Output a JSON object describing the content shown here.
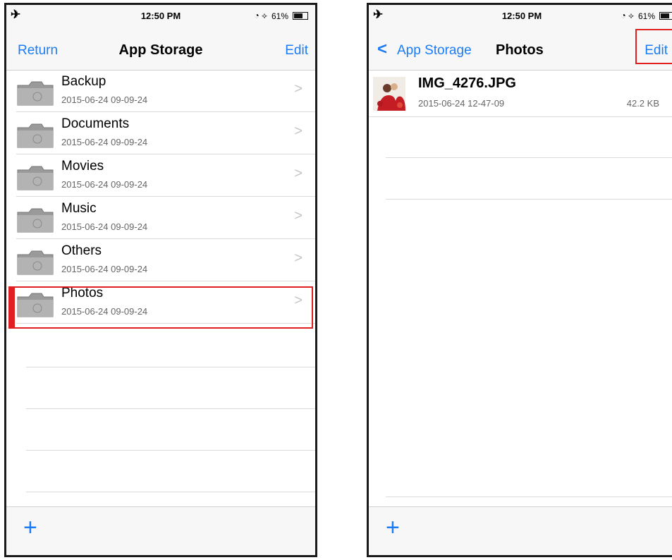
{
  "status": {
    "time": "12:50 PM",
    "battery": "61%"
  },
  "left": {
    "nav": {
      "left": "Return",
      "title": "App Storage",
      "right": "Edit"
    },
    "rows": [
      {
        "name": "Backup",
        "date": "2015-06-24 09-09-24"
      },
      {
        "name": "Documents",
        "date": "2015-06-24 09-09-24"
      },
      {
        "name": "Movies",
        "date": "2015-06-24 09-09-24"
      },
      {
        "name": "Music",
        "date": "2015-06-24 09-09-24"
      },
      {
        "name": "Others",
        "date": "2015-06-24 09-09-24"
      },
      {
        "name": "Photos",
        "date": "2015-06-24 09-09-24"
      }
    ],
    "toolbar": {
      "add": "+"
    }
  },
  "right": {
    "nav": {
      "back": "App Storage",
      "title": "Photos",
      "right": "Edit"
    },
    "file": {
      "name": "IMG_4276.JPG",
      "date": "2015-06-24 12-47-09",
      "size": "42.2 KB"
    },
    "toolbar": {
      "add": "+"
    }
  },
  "colors": {
    "accent": "#1b7cf5",
    "highlight": "#e02020"
  }
}
